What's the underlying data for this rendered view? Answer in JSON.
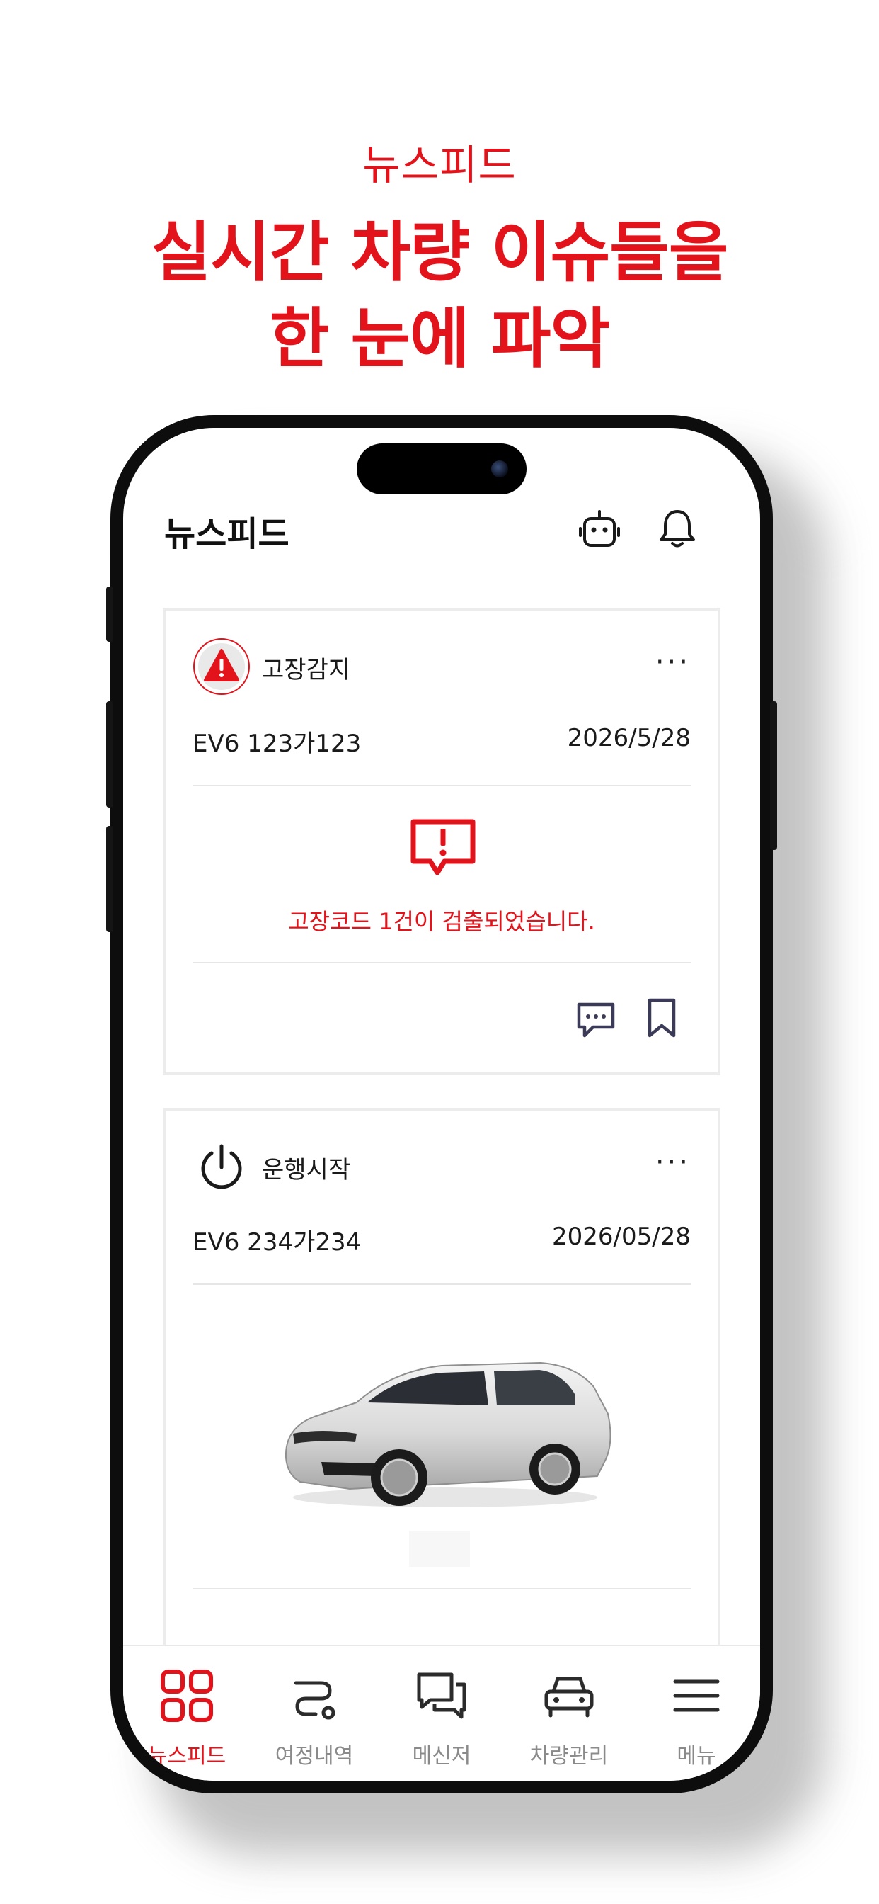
{
  "promo": {
    "subtitle": "뉴스피드",
    "title_line1": "실시간 차량 이슈들을",
    "title_line2": "한 눈에 파악"
  },
  "app": {
    "title": "뉴스피드",
    "header_icons": [
      "robot-icon",
      "bell-icon"
    ]
  },
  "feed": [
    {
      "type_label": "고장감지",
      "icon": "warning-triangle-icon",
      "more_label": "···",
      "plate": "EV6 123가123",
      "date": "2026/5/28",
      "message_icon": "alert-message-icon",
      "message": "고장코드 1건이 검출되었습니다.",
      "actions": [
        "comment-icon",
        "bookmark-icon"
      ]
    },
    {
      "type_label": "운행시작",
      "icon": "power-icon",
      "more_label": "···",
      "plate": "EV6 234가234",
      "date": "2026/05/28",
      "image": "car-image"
    }
  ],
  "nav": {
    "items": [
      {
        "label": "뉴스피드",
        "icon": "grid-icon",
        "active": true
      },
      {
        "label": "여정내역",
        "icon": "route-icon",
        "active": false
      },
      {
        "label": "메신저",
        "icon": "chat-icon",
        "active": false
      },
      {
        "label": "차량관리",
        "icon": "car-icon",
        "active": false
      },
      {
        "label": "메뉴",
        "icon": "menu-icon",
        "active": false
      }
    ]
  },
  "colors": {
    "accent": "#e3131b",
    "icon_dark": "#3b3b57",
    "inactive": "#8a8a8a"
  }
}
